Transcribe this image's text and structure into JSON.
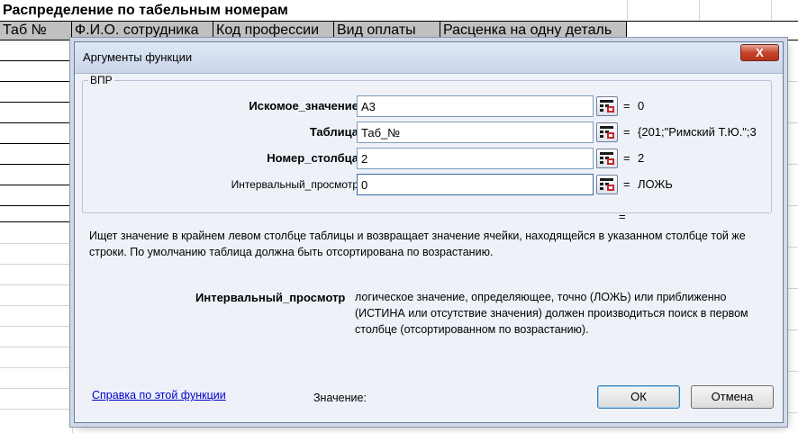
{
  "sheet": {
    "title": "Распределение по табельным номерам",
    "columns": [
      "Таб №",
      "Ф.И.О. сотрудника",
      "Код профессии",
      "Вид оплаты",
      "Расценка на одну деталь"
    ]
  },
  "dialog": {
    "title": "Аргументы функции",
    "close_label": "X",
    "group_label": "ВПР",
    "args": [
      {
        "label": "Искомое_значение",
        "value": "A3",
        "result": "0"
      },
      {
        "label": "Таблица",
        "value": "Таб_№",
        "result": "{201;\"Римский Т.Ю.\";3"
      },
      {
        "label": "Номер_столбца",
        "value": "2",
        "result": "2"
      },
      {
        "label": "Интервальный_просмотр",
        "value": "0",
        "result": "ЛОЖЬ"
      }
    ],
    "equals": "=",
    "description": "Ищет значение в крайнем левом столбце таблицы и возвращает значение ячейки, находящейся в указанном столбце той же строки. По умолчанию таблица должна быть отсортирована по возрастанию.",
    "arg_desc_name": "Интервальный_просмотр",
    "arg_desc_text": "логическое значение, определяющее, точно (ЛОЖЬ) или приближенно (ИСТИНА или отсутствие значения) должен производиться поиск в первом столбце (отсортированном по возрастанию).",
    "help_link": "Справка по этой функции",
    "value_label": "Значение:",
    "ok_label": "ОК",
    "cancel_label": "Отмена"
  }
}
